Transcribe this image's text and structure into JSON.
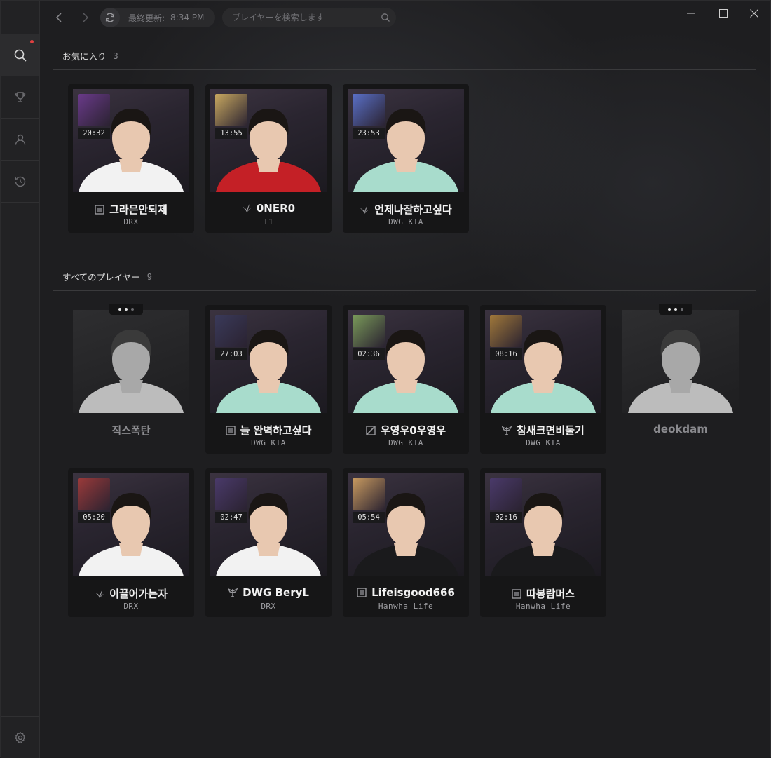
{
  "topbar": {
    "refresh_label": "最終更新:",
    "refresh_time": "8:34 PM",
    "search_placeholder": "プレイヤーを検索します"
  },
  "favorites": {
    "title": "お気に入り",
    "count": "3",
    "players": [
      {
        "name": "그라믄안되제",
        "team": "DRX",
        "timer": "20:32",
        "champ_color": "#6a3a8a",
        "jersey": "#f2f2f2",
        "rank": "square"
      },
      {
        "name": "0NER0",
        "team": "T1",
        "timer": "13:55",
        "champ_color": "#c8a860",
        "jersey": "#c42026",
        "rank": "leaf"
      },
      {
        "name": "언제나잘하고싶다",
        "team": "DWG KIA",
        "timer": "23:53",
        "champ_color": "#5a70c8",
        "jersey": "#a8dccc",
        "rank": "leaf"
      }
    ]
  },
  "all_players": {
    "title": "すべてのプレイヤー",
    "count": "9",
    "players": [
      {
        "name": "직스폭탄",
        "team": "",
        "timer": "",
        "inactive": true,
        "jersey": "#bcbcbc"
      },
      {
        "name": "늘 완벽하고싶다",
        "team": "DWG KIA",
        "timer": "27:03",
        "champ_color": "#3a3a5a",
        "jersey": "#a8dccc",
        "rank": "square"
      },
      {
        "name": "우영우0우영우",
        "team": "DWG KIA",
        "timer": "02:36",
        "champ_color": "#7a9a5a",
        "jersey": "#a8dccc",
        "rank": "slash"
      },
      {
        "name": "참새크면비둘기",
        "team": "DWG KIA",
        "timer": "08:16",
        "champ_color": "#a0783a",
        "jersey": "#a8dccc",
        "rank": "wing"
      },
      {
        "name": "deokdam",
        "team": "",
        "timer": "",
        "inactive": true,
        "jersey": "#bcbcbc"
      },
      {
        "name": "이끌어가는자",
        "team": "DRX",
        "timer": "05:20",
        "champ_color": "#9a3a3a",
        "jersey": "#f2f2f2",
        "rank": "leaf"
      },
      {
        "name": "DWG BeryL",
        "team": "DRX",
        "timer": "02:47",
        "champ_color": "#4a3a6a",
        "jersey": "#f2f2f2",
        "rank": "wing"
      },
      {
        "name": "Lifeisgood666",
        "team": "Hanwha Life",
        "timer": "05:54",
        "champ_color": "#c89a60",
        "jersey": "#1a1a1c",
        "rank": "square"
      },
      {
        "name": "따봉람머스",
        "team": "Hanwha Life",
        "timer": "02:16",
        "champ_color": "#4a3a6a",
        "jersey": "#1a1a1c",
        "rank": "square"
      }
    ]
  }
}
